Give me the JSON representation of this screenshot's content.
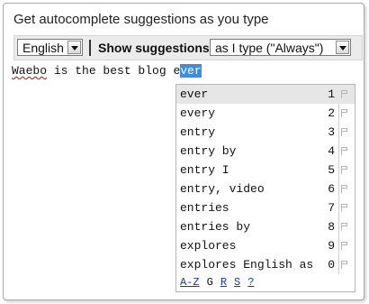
{
  "heading": "Get autocomplete suggestions as you type",
  "toolbar": {
    "language": "English",
    "show_label": "Show suggestions",
    "mode": "as I type (\"Always\")"
  },
  "editor": {
    "misspelled": "Waebo",
    "text_plain": " is the best blog e",
    "selected": "ver"
  },
  "suggestions": [
    {
      "text": "ever",
      "key": "1"
    },
    {
      "text": "every",
      "key": "2"
    },
    {
      "text": "entry",
      "key": "3"
    },
    {
      "text": "entry by",
      "key": "4"
    },
    {
      "text": "entry I",
      "key": "5"
    },
    {
      "text": "entry, video",
      "key": "6"
    },
    {
      "text": "entries",
      "key": "7"
    },
    {
      "text": "entries by",
      "key": "8"
    },
    {
      "text": "explores",
      "key": "9"
    },
    {
      "text": "explores English as",
      "key": "0"
    }
  ],
  "footer": {
    "az": "A-Z",
    "g": "G",
    "r": "R",
    "s": "S",
    "help": "?"
  }
}
